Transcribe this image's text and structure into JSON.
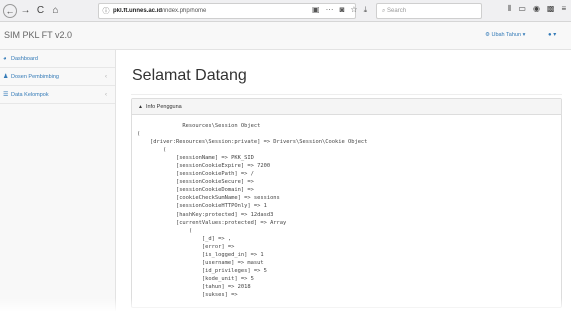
{
  "browser": {
    "back_icon": "back-arrow-icon",
    "forward_icon": "forward-arrow-icon",
    "reload_icon": "reload-icon",
    "home_icon": "home-icon",
    "url_host": "pkl.ft.unnes.ac.id",
    "url_path": "/index.php/home",
    "search_placeholder": "Search"
  },
  "app": {
    "brand": "SIM PKL FT v2.0",
    "year_menu": "Ubah Tahun",
    "accent": "#337ab7"
  },
  "sidebar": {
    "items": [
      {
        "label": "Dashboard",
        "icon": "dashboard-icon"
      },
      {
        "label": "Dosen Pembimbing",
        "icon": "user-icon",
        "has_submenu": true
      },
      {
        "label": "Data Kelompok",
        "icon": "list-icon",
        "has_submenu": true
      }
    ]
  },
  "main": {
    "title": "Selamat Datang",
    "panel_title": "Info Pengguna"
  },
  "session_dump": {
    "lines": [
      "              Resources\\Session Object",
      "(",
      "    [driver:Resources\\Session:private] => Drivers\\Session\\Cookie Object",
      "        (",
      "            [sessionName] => PKK_SID",
      "            [sessionCookieExpire] => 7200",
      "            [sessionCookiePath] => /",
      "            [sessionCookieSecure] =>",
      "            [sessionCookieDomain] =>",
      "            [cookieCheckSumName] => sessions",
      "            [sessionCookieHTTPOnly] => 1",
      "            [hashKey:protected] => 12dasd3",
      "            [currentValues:protected] => Array",
      "                (",
      "                    [_d] => ,",
      "                    [error] =>",
      "                    [is_logged_in] => 1",
      "                    [username] => masut",
      "                    [id_privileges] => 5",
      "                    [kode_unit] => 5",
      "                    [tahun] => 2018",
      "                    [sukses] =>"
    ]
  }
}
